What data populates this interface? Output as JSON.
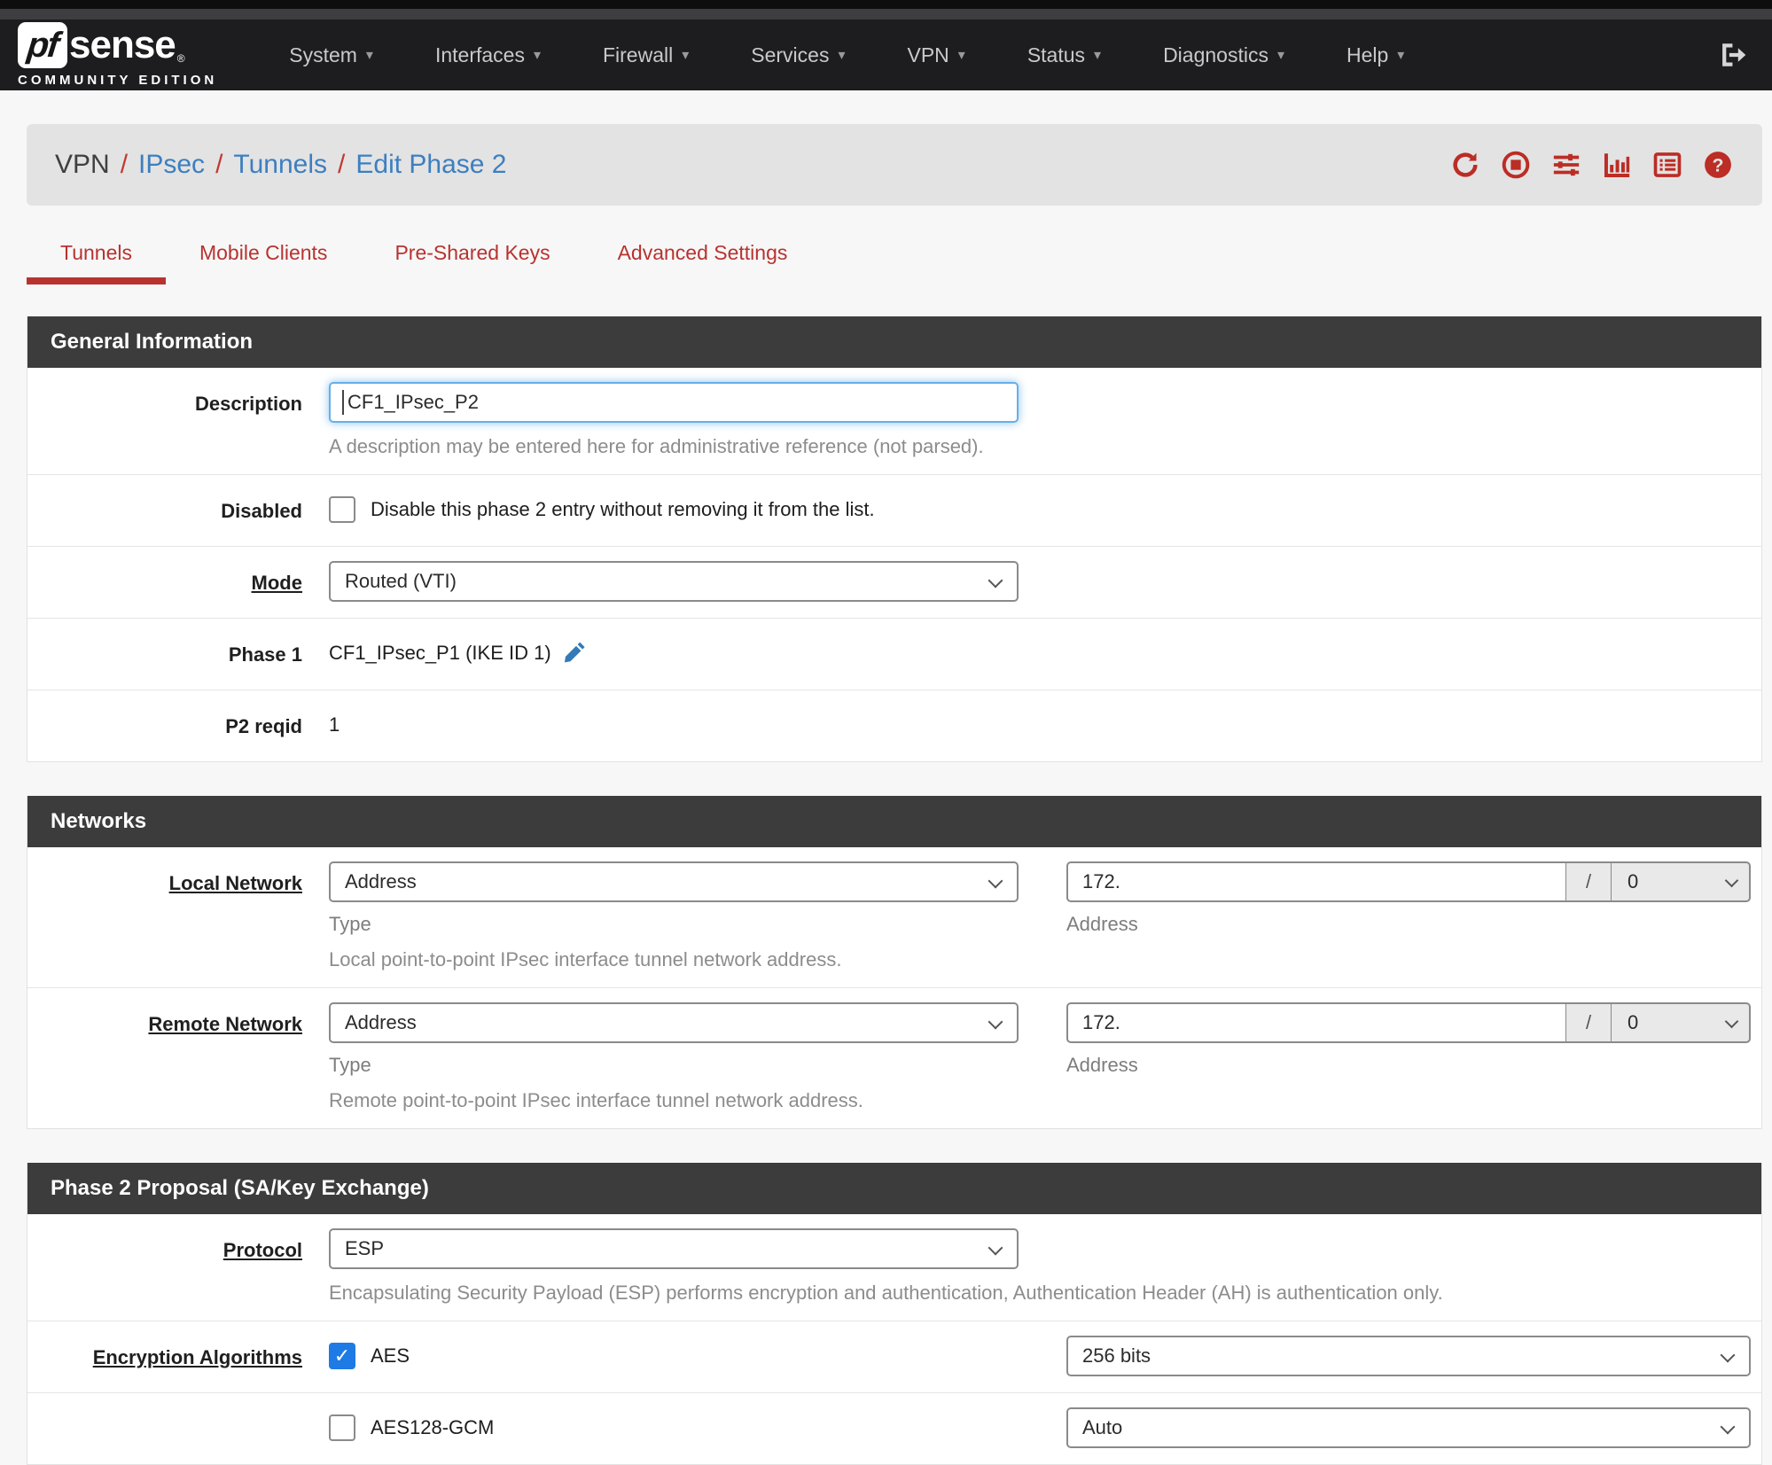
{
  "colors": {
    "navbar-bg": "#1d1d1f",
    "section-bg": "#3c3c3c",
    "red": "#bb2d25",
    "tab-red": "#b73330",
    "link-blue": "#3d7fc0",
    "focus-blue": "#66afe9",
    "check-blue": "#1e7ae5",
    "page-bg": "#f7f7f7"
  },
  "navbar": {
    "brand": {
      "pf": "pf",
      "sense": "sense",
      "reg": "®",
      "subtitle": "COMMUNITY EDITION"
    },
    "items": [
      {
        "label": "System"
      },
      {
        "label": "Interfaces"
      },
      {
        "label": "Firewall"
      },
      {
        "label": "Services"
      },
      {
        "label": "VPN"
      },
      {
        "label": "Status"
      },
      {
        "label": "Diagnostics"
      },
      {
        "label": "Help"
      }
    ],
    "logout_icon": "sign-out-icon",
    "caret": "▾"
  },
  "breadcrumb": {
    "current": "VPN",
    "sep": "/",
    "links": [
      "IPsec",
      "Tunnels",
      "Edit Phase 2"
    ],
    "icons": [
      "refresh-icon",
      "stop-circle-icon",
      "sliders-icon",
      "bar-chart-icon",
      "log-list-icon",
      "help-icon"
    ]
  },
  "tabs": [
    {
      "label": "Tunnels",
      "active": true
    },
    {
      "label": "Mobile Clients",
      "active": false
    },
    {
      "label": "Pre-Shared Keys",
      "active": false
    },
    {
      "label": "Advanced Settings",
      "active": false
    }
  ],
  "general": {
    "title": "General Information",
    "description": {
      "label": "Description",
      "value": "CF1_IPsec_P2",
      "help": "A description may be entered here for administrative reference (not parsed)."
    },
    "disabled": {
      "label": "Disabled",
      "checkbox_label": "Disable this phase 2 entry without removing it from the list.",
      "checked": false
    },
    "mode": {
      "label": "Mode",
      "value": "Routed (VTI)"
    },
    "phase1": {
      "label": "Phase 1",
      "value": "CF1_IPsec_P1 (IKE ID 1)",
      "edit_icon": "pencil-icon"
    },
    "p2reqid": {
      "label": "P2 reqid",
      "value": "1"
    }
  },
  "networks": {
    "title": "Networks",
    "local": {
      "label": "Local Network",
      "type_value": "Address",
      "type_caption": "Type",
      "address_value": "172.",
      "address_caption": "Address",
      "slash": "/",
      "prefix_value": "0",
      "help": "Local point-to-point IPsec interface tunnel network address."
    },
    "remote": {
      "label": "Remote Network",
      "type_value": "Address",
      "type_caption": "Type",
      "address_value": "172.",
      "address_caption": "Address",
      "slash": "/",
      "prefix_value": "0",
      "help": "Remote point-to-point IPsec interface tunnel network address."
    }
  },
  "proposal": {
    "title": "Phase 2 Proposal (SA/Key Exchange)",
    "protocol": {
      "label": "Protocol",
      "value": "ESP",
      "help": "Encapsulating Security Payload (ESP) performs encryption and authentication, Authentication Header (AH) is authentication only."
    },
    "encryption": {
      "label": "Encryption Algorithms",
      "algos": [
        {
          "name": "AES",
          "checked": true,
          "bits": "256 bits"
        },
        {
          "name": "AES128-GCM",
          "checked": false,
          "bits": "Auto"
        }
      ]
    }
  }
}
